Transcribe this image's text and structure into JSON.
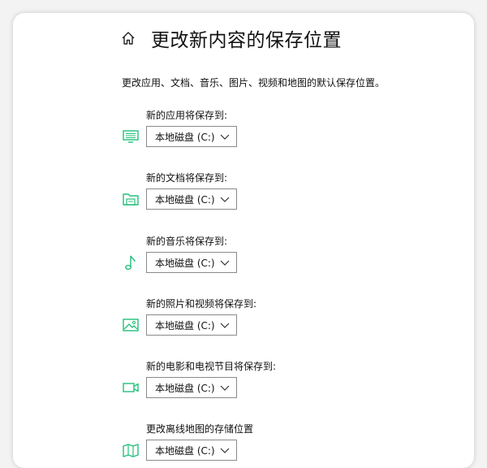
{
  "page": {
    "title": "更改新内容的保存位置",
    "description": "更改应用、文档、音乐、图片、视频和地图的默认保存位置。"
  },
  "theme": {
    "accent": "#21c07a",
    "text": "#111111",
    "border": "#8a8a8a"
  },
  "settings": [
    {
      "label": "新的应用将保存到:",
      "value": "本地磁盘 (C:)",
      "icon": "monitor-icon"
    },
    {
      "label": "新的文档将保存到:",
      "value": "本地磁盘 (C:)",
      "icon": "folder-icon"
    },
    {
      "label": "新的音乐将保存到:",
      "value": "本地磁盘 (C:)",
      "icon": "music-note-icon"
    },
    {
      "label": "新的照片和视频将保存到:",
      "value": "本地磁盘 (C:)",
      "icon": "picture-icon"
    },
    {
      "label": "新的电影和电视节目将保存到:",
      "value": "本地磁盘 (C:)",
      "icon": "video-camera-icon"
    },
    {
      "label": "更改离线地图的存储位置",
      "value": "本地磁盘 (C:)",
      "icon": "map-icon"
    }
  ]
}
